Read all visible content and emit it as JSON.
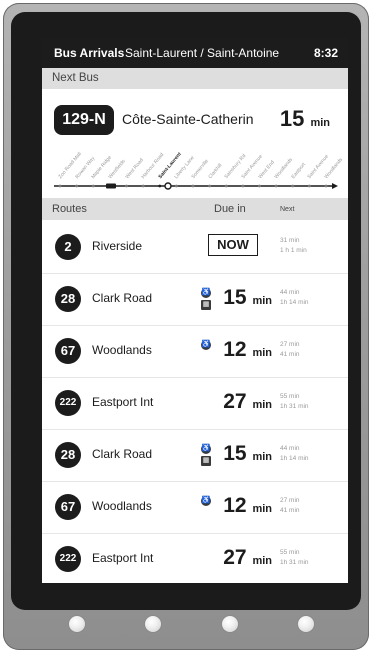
{
  "topbar": {
    "title": "Bus Arrivals",
    "stop": "Saint-Laurent / Saint-Antoine",
    "time": "8:32"
  },
  "next_bus": {
    "label": "Next Bus",
    "route": "129-N",
    "destination": "Côte-Sainte-Catherin",
    "eta_value": "15",
    "eta_unit": "min"
  },
  "route_map": {
    "stops": [
      "Zoo Road Mall",
      "Rowan Way",
      "Maple Ridge",
      "Westfields",
      "West Road",
      "Harbour Road",
      "Saint-Laurent",
      "Liberty Lane",
      "Somerville",
      "Clarkhill",
      "Sainsbury Rd",
      "Saint Avenue",
      "West End",
      "Woodlands",
      "Eastport",
      "Saint Avenue",
      "Woodlands"
    ],
    "current_stop": "Saint-Laurent"
  },
  "table": {
    "col_routes": "Routes",
    "col_due": "Due in",
    "col_next": "Next"
  },
  "rows": [
    {
      "route": "2",
      "name": "Riverside",
      "now": "NOW",
      "next1": "31 min",
      "next2": "1 h 1 min"
    },
    {
      "route": "28",
      "name": "Clark Road",
      "due": "15",
      "unit": "min",
      "next1": "44 min",
      "next2": "1h 14 min",
      "icons": [
        "wheelchair",
        "bike"
      ]
    },
    {
      "route": "67",
      "name": "Woodlands",
      "due": "12",
      "unit": "min",
      "next1": "27 min",
      "next2": "41 min",
      "icons": [
        "wheelchair"
      ]
    },
    {
      "route": "222",
      "name": "Eastport Int",
      "due": "27",
      "unit": "min",
      "next1": "55 min",
      "next2": "1h 31 min"
    },
    {
      "route": "28",
      "name": "Clark Road",
      "due": "15",
      "unit": "min",
      "next1": "44 min",
      "next2": "1h 14 min",
      "icons": [
        "wheelchair",
        "bike"
      ]
    },
    {
      "route": "67",
      "name": "Woodlands",
      "due": "12",
      "unit": "min",
      "next1": "27 min",
      "next2": "41 min",
      "icons": [
        "wheelchair"
      ]
    },
    {
      "route": "222",
      "name": "Eastport Int",
      "due": "27",
      "unit": "min",
      "next1": "55 min",
      "next2": "1h 31 min"
    }
  ]
}
